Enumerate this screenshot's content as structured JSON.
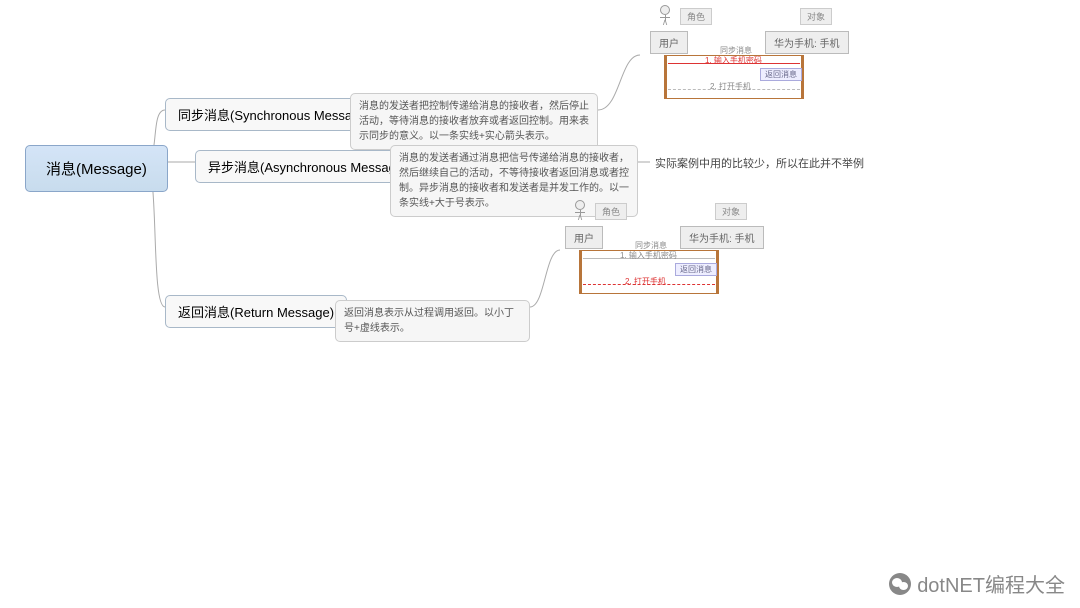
{
  "root": {
    "label": "消息(Message)"
  },
  "branches": {
    "sync": {
      "label": "同步消息(Synchronous Message)",
      "desc": "消息的发送者把控制传递给消息的接收者，然后停止活动，等待消息的接收者放弃或者返回控制。用来表示同步的意义。以一条实线+实心箭头表示。"
    },
    "async": {
      "label": "异步消息(Asynchronous Message)",
      "desc": "消息的发送者通过消息把信号传递给消息的接收者，然后继续自己的活动，不等待接收者返回消息或者控制。异步消息的接收者和发送者是并发工作的。以一条实线+大于号表示。",
      "note": "实际案例中用的比较少，所以在此并不举例"
    },
    "return": {
      "label": "返回消息(Return Message)",
      "desc": "返回消息表示从过程调用返回。以小丁号+虚线表示。"
    }
  },
  "seq_labels": {
    "role": "角色",
    "object": "对象",
    "user": "用户",
    "phone": "华为手机: 手机",
    "sync_msg": "同步消息",
    "input": "1. 输入手机密码",
    "return_msg": "返回消息",
    "open": "2. 打开手机"
  },
  "watermark": "dotNET编程大全",
  "chart_data": {
    "type": "mindmap",
    "root": "消息(Message)",
    "children": [
      {
        "label": "同步消息(Synchronous Message)",
        "description": "消息的发送者把控制传递给消息的接收者，然后停止活动，等待消息的接收者放弃或者返回控制。用来表示同步的意义。以一条实线+实心箭头表示。",
        "example": {
          "type": "sequence-diagram",
          "actors": [
            "用户(角色)",
            "华为手机: 手机(对象)"
          ],
          "messages": [
            {
              "from": "用户",
              "to": "华为手机",
              "label": "1. 输入手机密码",
              "kind": "同步消息",
              "highlight": true
            },
            {
              "from": "华为手机",
              "to": "用户",
              "label": "返回消息",
              "kind": "return"
            },
            {
              "from": "华为手机",
              "to": "用户",
              "label": "2. 打开手机",
              "kind": "return-dashed"
            }
          ]
        }
      },
      {
        "label": "异步消息(Asynchronous Message)",
        "description": "消息的发送者通过消息把信号传递给消息的接收者，然后继续自己的活动，不等待接收者返回消息或者控制。异步消息的接收者和发送者是并发工作的。以一条实线+大于号表示。",
        "note": "实际案例中用的比较少，所以在此并不举例"
      },
      {
        "label": "返回消息(Return Message)",
        "description": "返回消息表示从过程调用返回。以小丁号+虚线表示。",
        "example": {
          "type": "sequence-diagram",
          "actors": [
            "用户(角色)",
            "华为手机: 手机(对象)"
          ],
          "messages": [
            {
              "from": "用户",
              "to": "华为手机",
              "label": "同步消息",
              "kind": "sync"
            },
            {
              "from": "用户",
              "to": "华为手机",
              "label": "1. 输入手机密码",
              "kind": "sync"
            },
            {
              "from": "华为手机",
              "to": "用户",
              "label": "返回消息",
              "kind": "return"
            },
            {
              "from": "华为手机",
              "to": "用户",
              "label": "2. 打开手机",
              "kind": "return-dashed",
              "highlight": true
            }
          ]
        }
      }
    ]
  }
}
